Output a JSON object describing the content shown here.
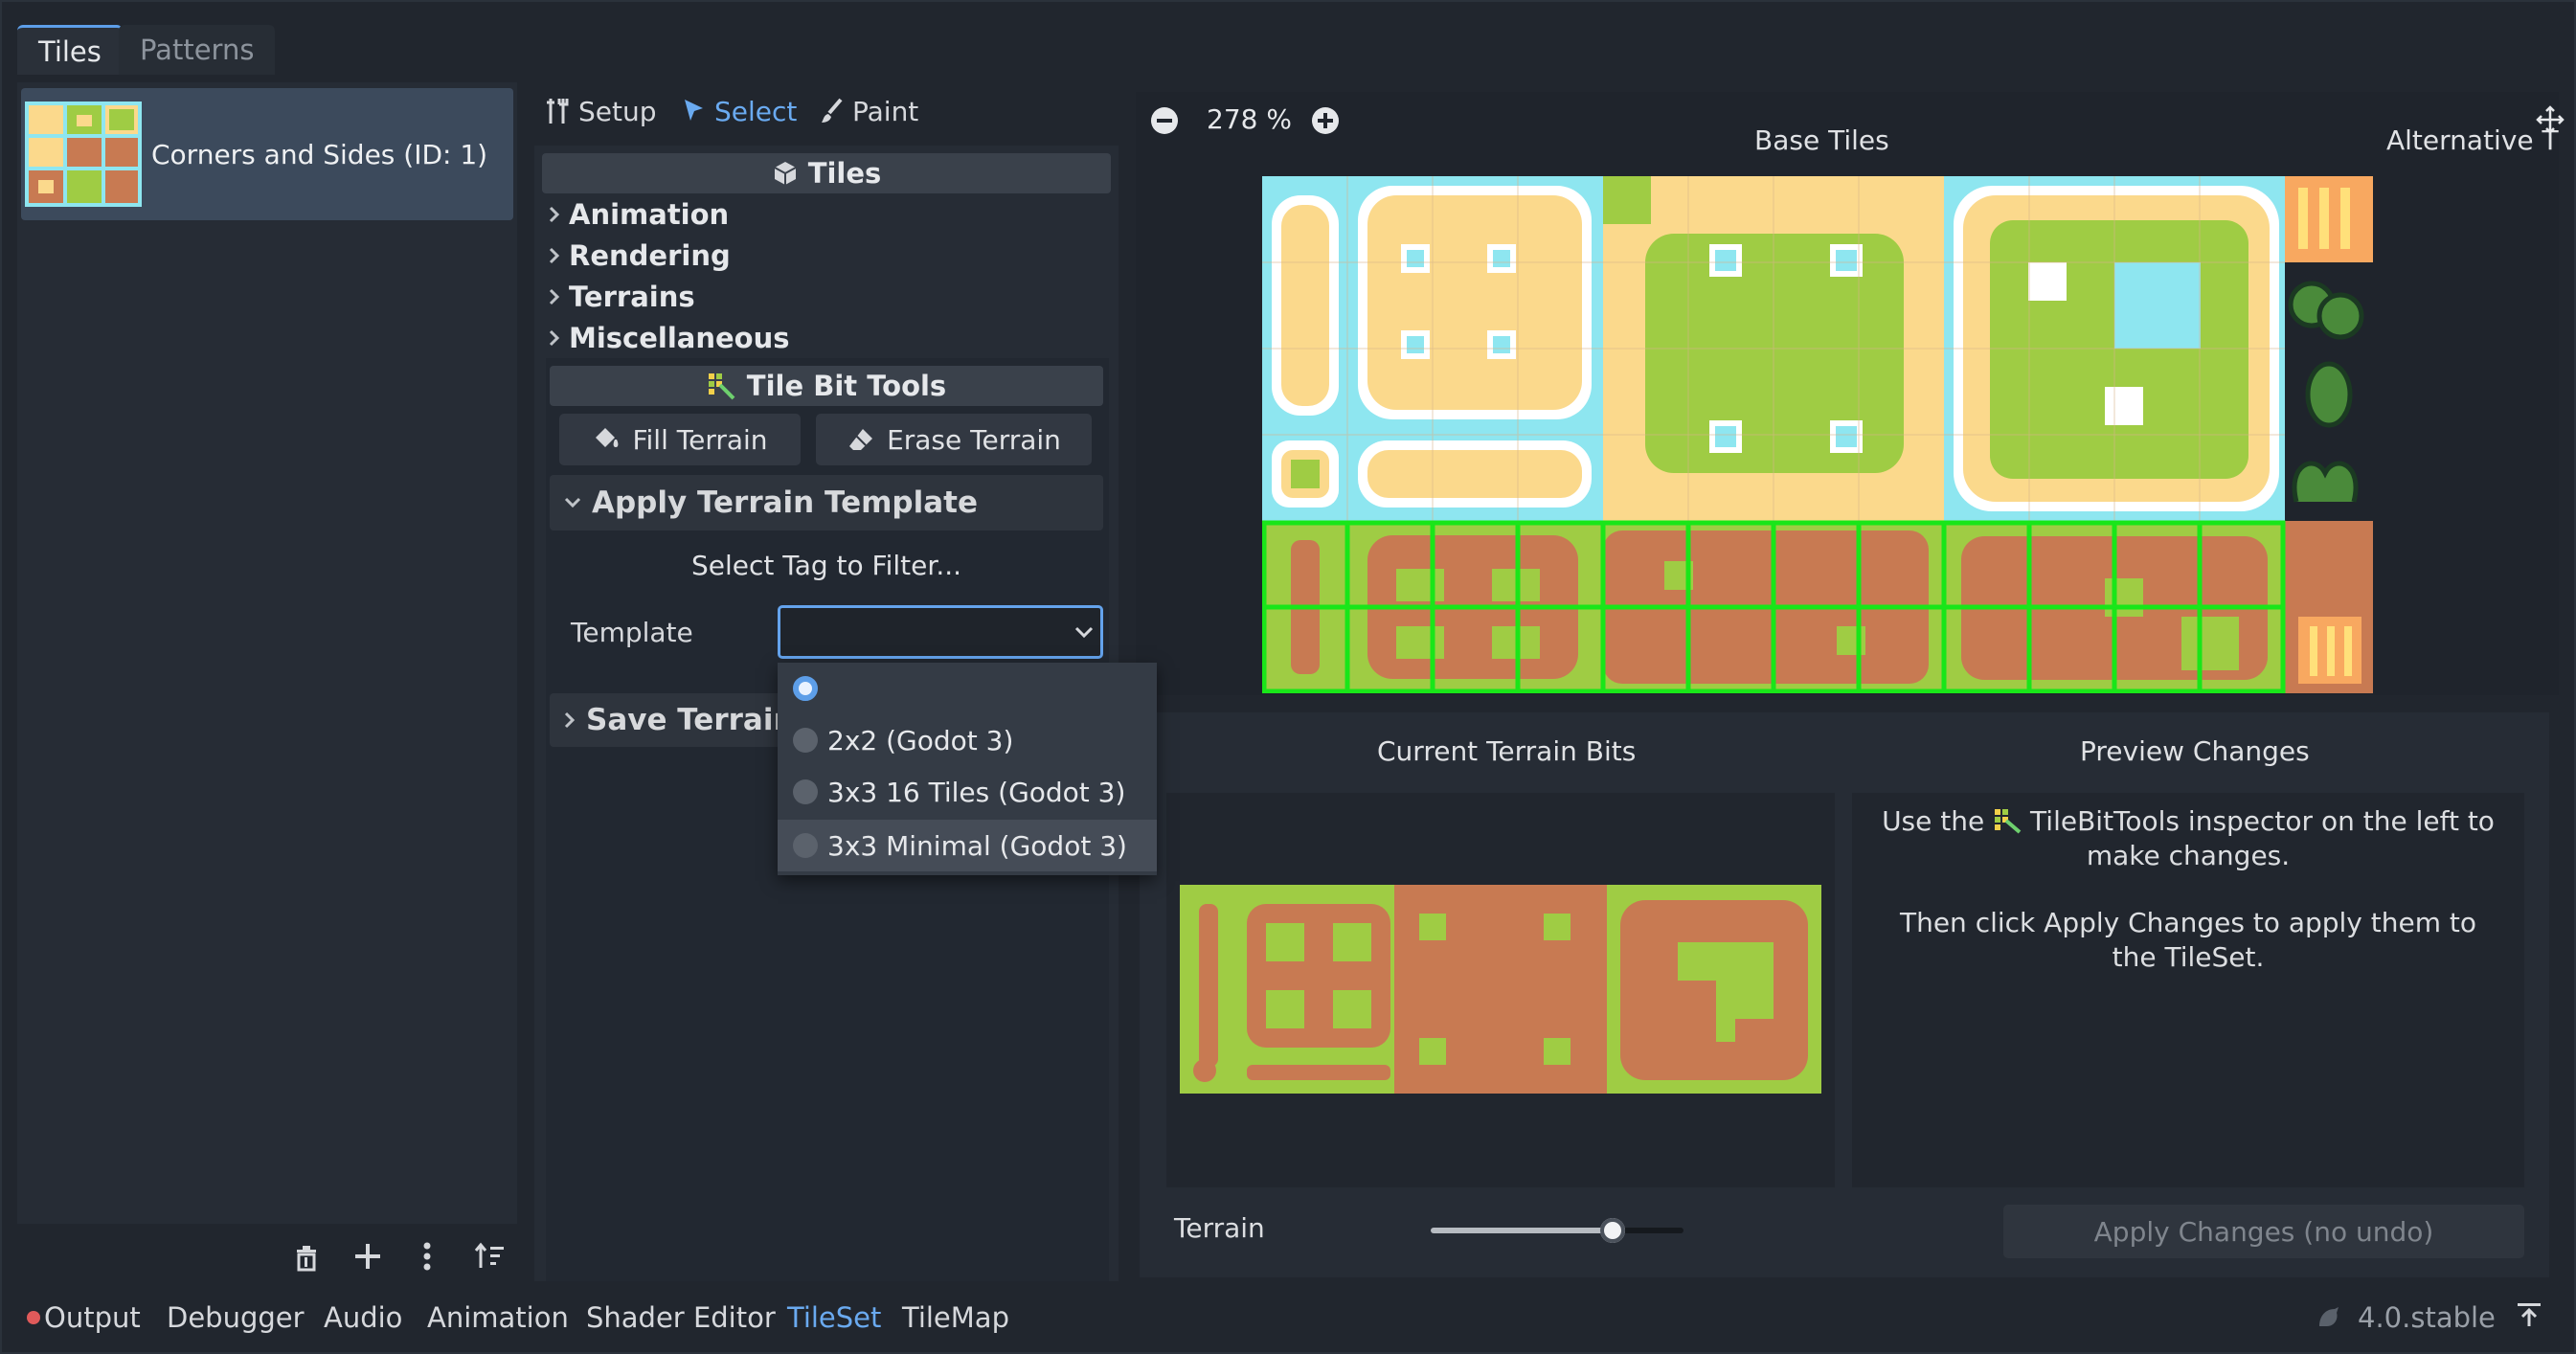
{
  "top_tabs": {
    "tiles": "Tiles",
    "patterns": "Patterns"
  },
  "sources": [
    {
      "label": "Corners and Sides (ID: 1)"
    }
  ],
  "modes": {
    "setup": "Setup",
    "select": "Select",
    "paint": "Paint"
  },
  "inspector": {
    "header": "Tiles",
    "sections": [
      "Animation",
      "Rendering",
      "Terrains",
      "Miscellaneous"
    ],
    "tilebit": {
      "header": "Tile Bit Tools",
      "fill": "Fill Terrain",
      "erase": "Erase Terrain",
      "apply_header": "Apply Terrain Template",
      "filter_hint": "Select Tag to Filter...",
      "template_label": "Template",
      "template_value": "",
      "options": [
        "",
        "2x2 (Godot 3)",
        "3x3 16 Tiles (Godot 3)",
        "3x3 Minimal (Godot 3)"
      ],
      "save_header": "Save Terrain T"
    }
  },
  "atlas": {
    "zoom": "278 %",
    "base_tiles": "Base Tiles",
    "alternative": "Alternative Ti"
  },
  "preview": {
    "current_bits": "Current Terrain Bits",
    "preview_changes": "Preview Changes",
    "instructions_prefix": "Use the",
    "instructions_1": "TileBitTools inspector on the left to make changes.",
    "instructions_2": "Then click Apply Changes to apply them to the TileSet.",
    "terrain_label": "Terrain",
    "terrain_slider": 0.72,
    "apply_button": "Apply Changes (no undo)"
  },
  "bottom_bar": {
    "tabs": [
      "Output",
      "Debugger",
      "Audio",
      "Animation",
      "Shader Editor",
      "TileSet",
      "TileMap"
    ],
    "active": "TileSet",
    "version": "4.0.stable"
  },
  "colors": {
    "accent": "#5d9ee8",
    "water": "#8ee6f0",
    "sand": "#fbd98c",
    "grass": "#9fcc44",
    "dirt": "#c87a52",
    "terrain_outline": "#19e619",
    "output_dot": "#e05a5a"
  }
}
